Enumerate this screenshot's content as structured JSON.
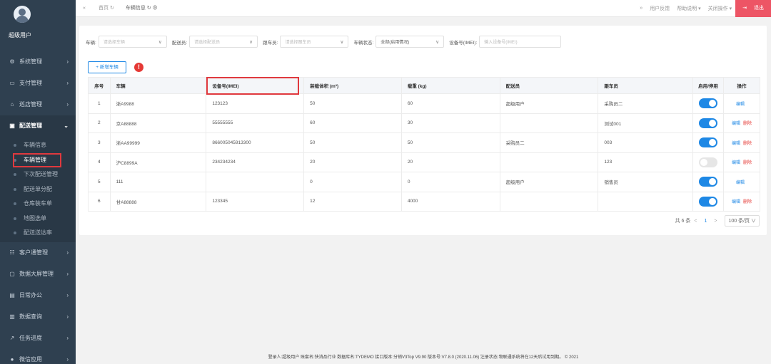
{
  "sidebar": {
    "user_name": "超级用户",
    "menu_before": [
      {
        "icon": "⚙",
        "label": "系统管理"
      },
      {
        "icon": "▭",
        "label": "支付管理"
      },
      {
        "icon": "⌂",
        "label": "巡店管理"
      }
    ],
    "active_menu": {
      "icon": "▣",
      "label": "配送管理"
    },
    "submenu": [
      "车辆信息",
      "车辆管理",
      "下次配送管理",
      "配送单分配",
      "仓库装车单",
      "地图选单",
      "配送送达率"
    ],
    "menu_after": [
      {
        "icon": "☷",
        "label": "客户通管理"
      },
      {
        "icon": "▢",
        "label": "数据大屏管理"
      },
      {
        "icon": "▤",
        "label": "日常办公"
      },
      {
        "icon": "▥",
        "label": "数据查询"
      },
      {
        "icon": "↗",
        "label": "任务进度"
      },
      {
        "icon": "●",
        "label": "微信应用"
      }
    ]
  },
  "topbar": {
    "tabs": [
      "首页",
      "车辆信息"
    ],
    "right": [
      "用户反馈",
      "帮助说明 ▾",
      "关闭操作 ▾"
    ],
    "logout": "退出"
  },
  "filters": [
    {
      "label": "车辆:",
      "value": "请选择车辆",
      "filled": false
    },
    {
      "label": "配送员:",
      "value": "请选择配送员",
      "filled": false
    },
    {
      "label": "跟车员:",
      "value": "请选择跟车员",
      "filled": false
    },
    {
      "label": "车辆状态:",
      "value": "全部(启用情况)",
      "filled": true
    }
  ],
  "imei_filter": {
    "label": "设备号(IMEI):",
    "placeholder": "输入设备号(IMEI)"
  },
  "add_button": "+ 新增车辆",
  "table": {
    "headers": [
      "序号",
      "车辆",
      "设备号(IMEI)",
      "装载体积 (m³)",
      "载重 (kg)",
      "配送员",
      "跟车员",
      "启用/停用",
      "操作"
    ],
    "rows": [
      {
        "no": "1",
        "vehicle": "浙A9988",
        "imei": "123123",
        "volume": "50",
        "load": "60",
        "driver": "超级用户",
        "escort": "采购员二",
        "enabled": true,
        "actions": [
          "编辑"
        ]
      },
      {
        "no": "2",
        "vehicle": "京A88888",
        "imei": "55555555",
        "volume": "60",
        "load": "30",
        "driver": "",
        "escort": "测试001",
        "enabled": true,
        "actions": [
          "编辑",
          "删除"
        ]
      },
      {
        "no": "3",
        "vehicle": "浙AA99999",
        "imei": "866005045913300",
        "volume": "50",
        "load": "50",
        "driver": "采购员二",
        "escort": "003",
        "enabled": true,
        "actions": [
          "编辑",
          "删除"
        ]
      },
      {
        "no": "4",
        "vehicle": "沪C8899A",
        "imei": "234234234",
        "volume": "20",
        "load": "20",
        "driver": "",
        "escort": "123",
        "enabled": false,
        "actions": [
          "编辑",
          "删除"
        ]
      },
      {
        "no": "5",
        "vehicle": "111",
        "imei": "",
        "volume": "0",
        "load": "0",
        "driver": "超级用户",
        "escort": "销售员",
        "enabled": true,
        "actions": [
          "编辑"
        ]
      },
      {
        "no": "6",
        "vehicle": "甘A88888",
        "imei": "123345",
        "volume": "12",
        "load": "4000",
        "driver": "",
        "escort": "",
        "enabled": true,
        "actions": [
          "编辑",
          "删除"
        ]
      }
    ]
  },
  "pagination": {
    "total": "共 6 条",
    "prev": "<",
    "page": "1",
    "next": ">",
    "size": "100 条/页 ∨"
  },
  "footer": "登录人:超级用户   账套名:快消品行业   数据库名:TYDEMO   接口版本:分销V3Top V9.90   版本号:V7.8.0 (2020.11.06)   注册状态:物联通系统将在12天后试用到期。   © 2021",
  "colors": {
    "sidebar_bg": "#2f4050",
    "primary": "#1e88e5",
    "danger": "#e53935",
    "highlight": "#e0393e"
  }
}
